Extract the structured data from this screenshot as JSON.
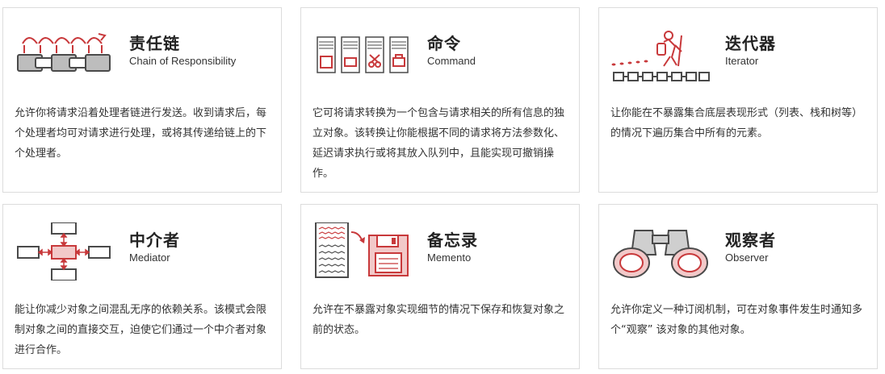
{
  "colors": {
    "accent": "#c8393b",
    "icon_gray": "#4a4a4a",
    "border": "#dcdcdc"
  },
  "patterns": [
    {
      "icon": "chain-of-responsibility-icon",
      "title": "责任链",
      "subtitle": "Chain of Responsibility",
      "description": "允许你将请求沿着处理者链进行发送。收到请求后，每个处理者均可对请求进行处理，或将其传递给链上的下个处理者。"
    },
    {
      "icon": "command-icon",
      "title": "命令",
      "subtitle": "Command",
      "description": "它可将请求转换为一个包含与请求相关的所有信息的独立对象。该转换让你能根据不同的请求将方法参数化、延迟请求执行或将其放入队列中，且能实现可撤销操作。"
    },
    {
      "icon": "iterator-icon",
      "title": "迭代器",
      "subtitle": "Iterator",
      "description": "让你能在不暴露集合底层表现形式（列表、栈和树等）的情况下遍历集合中所有的元素。"
    },
    {
      "icon": "mediator-icon",
      "title": "中介者",
      "subtitle": "Mediator",
      "description": "能让你减少对象之间混乱无序的依赖关系。该模式会限制对象之间的直接交互，迫使它们通过一个中介者对象进行合作。"
    },
    {
      "icon": "memento-icon",
      "title": "备忘录",
      "subtitle": "Memento",
      "description": "允许在不暴露对象实现细节的情况下保存和恢复对象之前的状态。"
    },
    {
      "icon": "observer-icon",
      "title": "观察者",
      "subtitle": "Observer",
      "description": "允许你定义一种订阅机制，可在对象事件发生时通知多个“观察” 该对象的其他对象。"
    }
  ]
}
